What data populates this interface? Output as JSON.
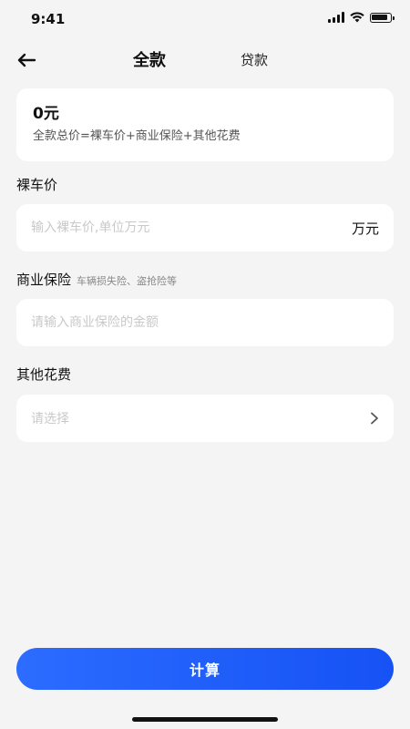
{
  "status_bar": {
    "time": "9:41",
    "icons": [
      "signal-icon",
      "wifi-icon",
      "battery-icon"
    ]
  },
  "header": {
    "back_icon": "arrow-left-icon",
    "tab_full": "全款",
    "tab_loan": "贷款"
  },
  "summary": {
    "amount": "0元",
    "formula": "全款总价=裸车价+商业保险+其他花费"
  },
  "car_price": {
    "label": "裸车价",
    "placeholder": "输入裸车价,单位万元",
    "value": "",
    "unit": "万元"
  },
  "insurance": {
    "label": "商业保险",
    "sublabel": "车辆损失险、盗抢险等",
    "placeholder": "请输入商业保险的金额",
    "value": ""
  },
  "other_fees": {
    "label": "其他花费",
    "placeholder": "请选择",
    "icon": "chevron-right-icon"
  },
  "actions": {
    "calculate": "计算"
  },
  "colors": {
    "background": "#f4f4f4",
    "card": "#ffffff",
    "accent": "#1d5cf7",
    "placeholder": "#c9c9c9"
  }
}
